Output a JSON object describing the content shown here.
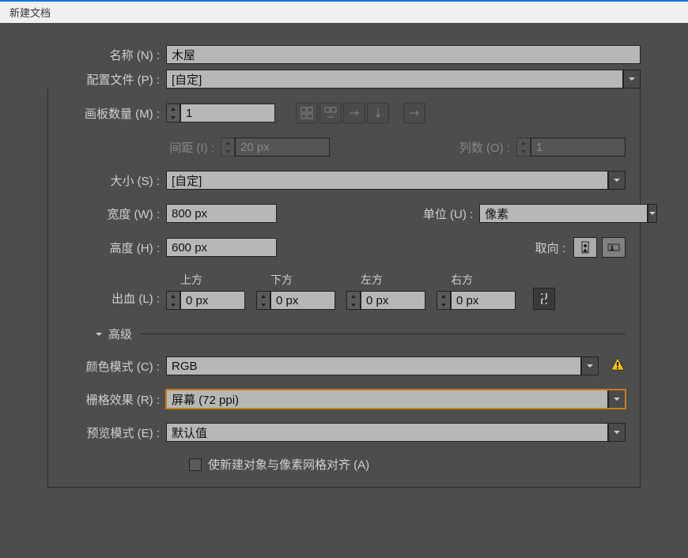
{
  "title": "新建文档",
  "name": {
    "label": "名称 (N) :",
    "value": "木屋"
  },
  "profile": {
    "label": "配置文件 (P) :",
    "value": "[自定]"
  },
  "artboards": {
    "label": "画板数量 (M) :",
    "value": "1"
  },
  "spacing": {
    "label": "间距 (I) :",
    "value": "20 px"
  },
  "columns": {
    "label": "列数 (O) :",
    "value": "1"
  },
  "size": {
    "label": "大小 (S) :",
    "value": "[自定]"
  },
  "width": {
    "label": "宽度 (W) :",
    "value": "800 px"
  },
  "height": {
    "label": "高度 (H) :",
    "value": "600 px"
  },
  "units": {
    "label": "单位 (U) :",
    "value": "像素"
  },
  "orient": {
    "label": "取向 :"
  },
  "bleed": {
    "label": "出血 (L) :",
    "top": {
      "hdr": "上方",
      "value": "0 px"
    },
    "bottom": {
      "hdr": "下方",
      "value": "0 px"
    },
    "left": {
      "hdr": "左方",
      "value": "0 px"
    },
    "right": {
      "hdr": "右方",
      "value": "0 px"
    }
  },
  "advanced": {
    "label": "高级"
  },
  "colorMode": {
    "label": "颜色模式 (C) :",
    "value": "RGB"
  },
  "raster": {
    "label": "栅格效果 (R) :",
    "value": "屏幕 (72 ppi)"
  },
  "preview": {
    "label": "预览模式 (E) :",
    "value": "默认值"
  },
  "alignGrid": {
    "label": "使新建对象与像素网格对齐 (A)"
  }
}
